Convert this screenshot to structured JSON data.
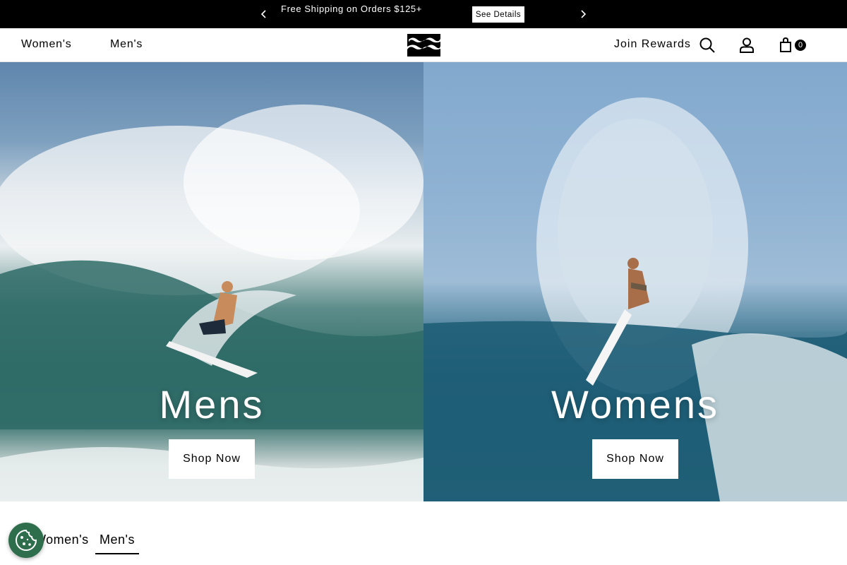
{
  "announcement": {
    "message": "Free Shipping on Orders $125+",
    "details_label": "See Details",
    "prev_icon": "chevron-left-icon",
    "next_icon": "chevron-right-icon"
  },
  "header": {
    "nav": [
      "Women's",
      "Men's"
    ],
    "logo_icon": "billabong-logo",
    "rewards_label": "Join Rewards",
    "icons": [
      "search-icon",
      "account-icon",
      "shopping-bag-icon"
    ],
    "bag_count": "0"
  },
  "hero": [
    {
      "title": "Mens",
      "button_label": "Shop Now"
    },
    {
      "title": "Womens",
      "button_label": "Shop Now"
    }
  ],
  "tabs": {
    "items": [
      "Women's",
      "Men's"
    ],
    "active": "Men's"
  },
  "cookie": {
    "icon": "cookie-icon"
  },
  "colors": {
    "black": "#000000",
    "white": "#ffffff",
    "cookie_green": "#2f6e4c"
  }
}
